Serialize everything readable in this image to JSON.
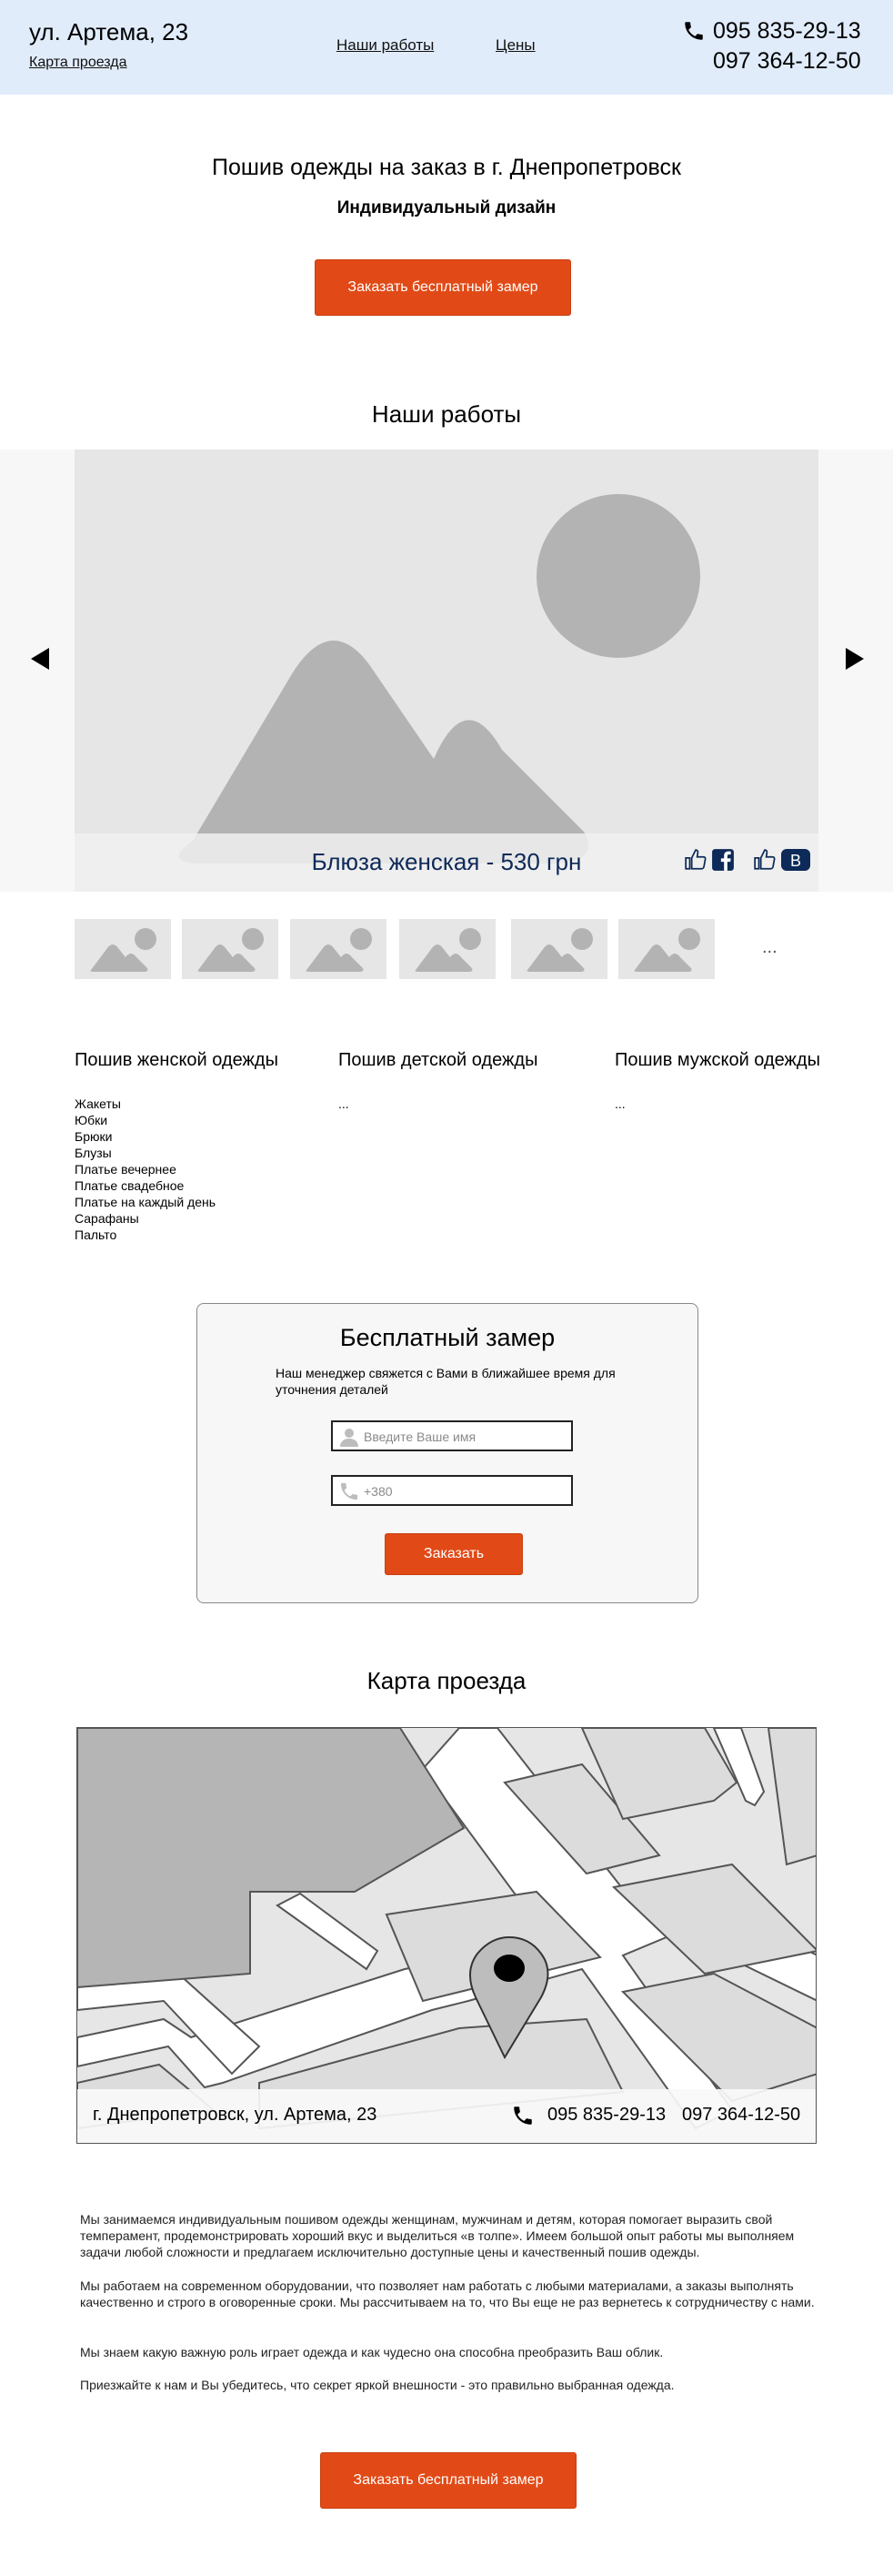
{
  "header": {
    "address": "ул. Артема, 23",
    "map_link": "Карта проезда",
    "nav": [
      "Наши работы",
      "Цены"
    ],
    "phone1": "095 835-29-13",
    "phone2": "097 364-12-50"
  },
  "hero": {
    "title": "Пошив одежды на заказ в г. Днепропетровск",
    "subtitle": "Индивидуальный дизайн",
    "button": "Заказать бесплатный замер"
  },
  "works": {
    "title": "Наши работы",
    "caption": "Блюза женская - 530 грн",
    "thumb_count": 6,
    "more": "..."
  },
  "categories": [
    {
      "title": "Пошив женской одежды",
      "items": [
        "Жакеты",
        "Юбки",
        "Брюки",
        "Блузы",
        "Платье вечернее",
        "Платье свадебное",
        "Платье на каждый день",
        "Сарафаны",
        "Пальто"
      ]
    },
    {
      "title": "Пошив детской одежды",
      "items": [
        "..."
      ]
    },
    {
      "title": "Пошив мужской одежды",
      "items": [
        "..."
      ]
    }
  ],
  "form": {
    "title": "Бесплатный замер",
    "description": "Наш менеджер свяжется с Вами в ближайшее время для уточнения деталей",
    "name_placeholder": "Введите Ваше имя",
    "phone_placeholder": "+380",
    "submit": "Заказать"
  },
  "map": {
    "title": "Карта проезда",
    "address": "г. Днепропетровск, ул. Артема, 23",
    "phone1": "095 835-29-13",
    "phone2": "097 364-12-50"
  },
  "about": [
    "Мы занимаемся индивидуальным пошивом одежды женщинам, мужчинам и детям, которая помогает выразить свой темперамент, продемонстрировать хороший вкус и выделиться «в толпе». Имеем большой опыт работы мы выполняем задачи любой сложности и предлагаем исключительно доступные цены и качественный пошив одежды.",
    "Мы работаем на современном оборудовании, что позволяет нам работать с любыми материалами, а заказы выполнять качественно и строго в оговоренные сроки. Мы рассчитываем на то, что Вы еще не раз вернетесь к сотрудничеству с нами.",
    "Мы знаем какую важную роль играет одежда и как чудесно она способна преобразить Ваш облик.",
    "Приезжайте к нам и Вы убедитесь, что секрет яркой внешности - это правильно выбранная одежда."
  ],
  "bottom_button": "Заказать бесплатный замер",
  "colors": {
    "header_bg": "#e1ecfb",
    "accent": "#e14a17",
    "caption": "#0d2a58"
  },
  "icons": [
    "phone-icon",
    "image-placeholder-icon",
    "like-icon",
    "facebook-icon",
    "vk-icon",
    "user-icon",
    "map-pin-icon",
    "arrow-left-icon",
    "arrow-right-icon"
  ]
}
